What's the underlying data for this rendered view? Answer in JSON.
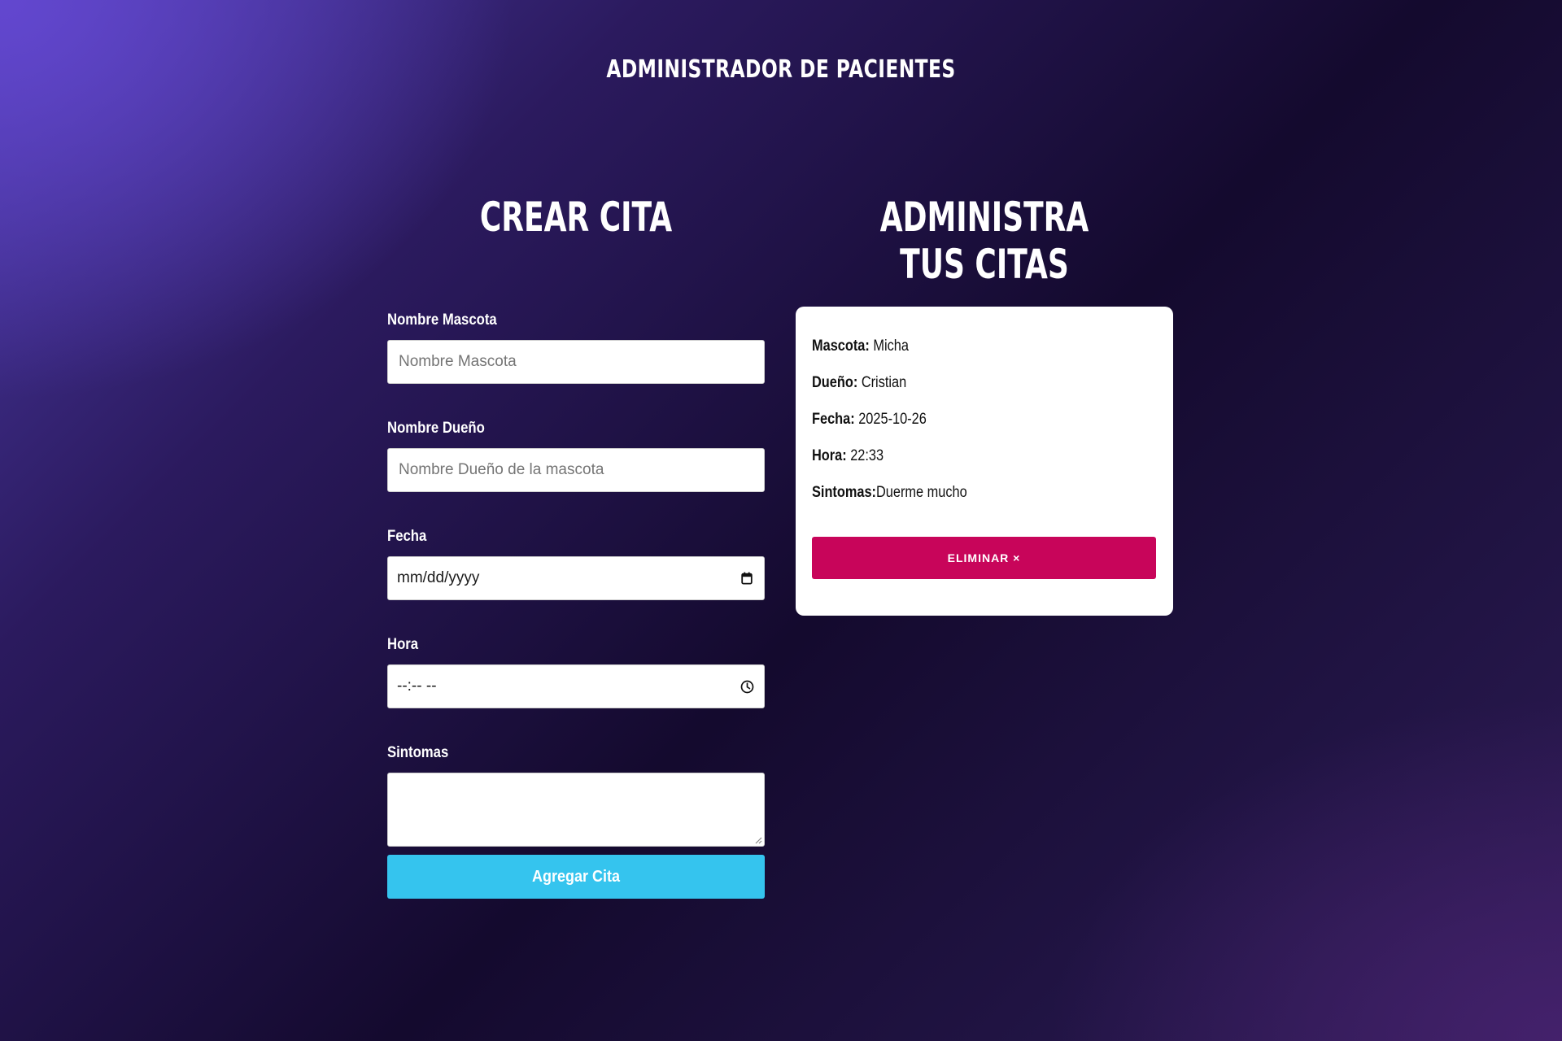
{
  "header": {
    "title": "ADMINISTRADOR DE PACIENTES"
  },
  "form_section": {
    "title": "CREAR CITA",
    "fields": {
      "pet_name": {
        "label": "Nombre Mascota",
        "placeholder": "Nombre Mascota",
        "value": ""
      },
      "owner_name": {
        "label": "Nombre Dueño",
        "placeholder": "Nombre Dueño de la mascota",
        "value": ""
      },
      "date": {
        "label": "Fecha",
        "display": "mm/dd/yyyy",
        "icon": "calendar-icon"
      },
      "time": {
        "label": "Hora",
        "display": "--:-- --",
        "icon": "clock-icon"
      },
      "symptoms": {
        "label": "Sintomas",
        "value": ""
      }
    },
    "submit_label": "Agregar Cita"
  },
  "appointments_section": {
    "title": "ADMINISTRA TUS CITAS",
    "appointments": [
      {
        "pet_label": "Mascota:",
        "pet": "Micha",
        "owner_label": "Dueño:",
        "owner": "Cristian",
        "date_label": "Fecha:",
        "date": "2025-10-26",
        "time_label": "Hora:",
        "time": "22:33",
        "symptoms_label": "Sintomas:",
        "symptoms": "Duerme mucho",
        "delete_label": "ELIMINAR ×"
      }
    ]
  },
  "colors": {
    "submit_button": "#35c4ee",
    "delete_button": "#c8055a",
    "background_dark": "#140a2e",
    "background_purple": "#4b3aa6"
  }
}
